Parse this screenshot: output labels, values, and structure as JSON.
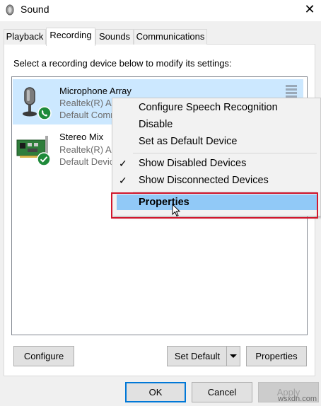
{
  "window": {
    "title": "Sound",
    "close_glyph": "✕"
  },
  "tabs": [
    {
      "label": "Playback",
      "active": false
    },
    {
      "label": "Recording",
      "active": true
    },
    {
      "label": "Sounds",
      "active": false
    },
    {
      "label": "Communications",
      "active": false
    }
  ],
  "instruction": "Select a recording device below to modify its settings:",
  "devices": [
    {
      "name": "Microphone Array",
      "driver": "Realtek(R) Au",
      "status": "Default Comm",
      "icon": "microphone-icon",
      "badge": "phone-badge-icon",
      "selected": true
    },
    {
      "name": "Stereo Mix",
      "driver": "Realtek(R) Au",
      "status": "Default Devic",
      "icon": "sound-card-icon",
      "badge": "check-badge-icon",
      "selected": false
    }
  ],
  "context_menu": {
    "items": [
      {
        "label": "Configure Speech Recognition",
        "checked": false
      },
      {
        "label": "Disable",
        "checked": false
      },
      {
        "label": "Set as Default Device",
        "checked": false
      },
      {
        "label": "Show Disabled Devices",
        "checked": true
      },
      {
        "label": "Show Disconnected Devices",
        "checked": true
      },
      {
        "label": "Properties",
        "checked": false,
        "highlighted": true
      }
    ]
  },
  "panel_buttons": {
    "configure": "Configure",
    "set_default": "Set Default",
    "properties": "Properties"
  },
  "dialog_buttons": {
    "ok": "OK",
    "cancel": "Cancel",
    "apply": "Apply"
  },
  "watermark": "wsxdn.com",
  "colors": {
    "selection": "#cce8ff",
    "menu_highlight": "#91c9f7",
    "annotation_red": "#d1172d",
    "accent": "#0078d7"
  }
}
